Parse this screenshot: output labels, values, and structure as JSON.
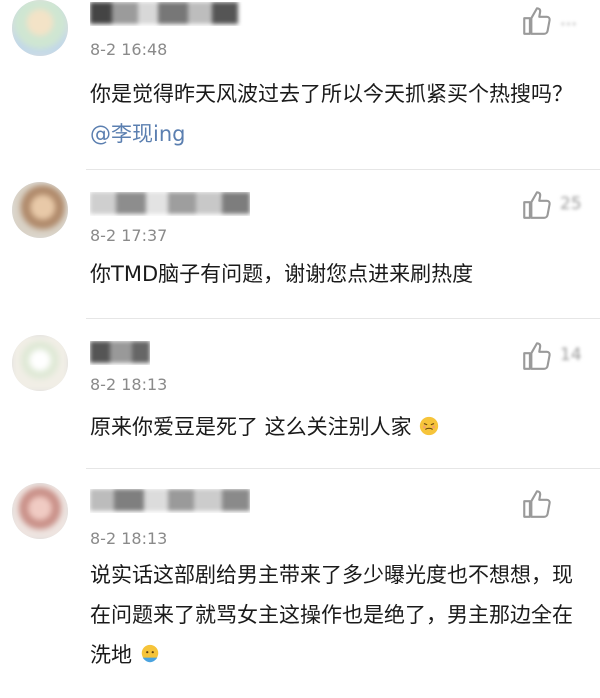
{
  "comments": [
    {
      "time": "8-2 16:48",
      "text": "你是觉得昨天风波过去了所以今天抓紧买个热搜吗？",
      "mention": "@李现ing"
    },
    {
      "time": "8-2 17:37",
      "text": "你TMD脑子有问题，谢谢您点进来刷热度",
      "like_count": "25"
    },
    {
      "time": "8-2 18:13",
      "text": "原来你爱豆是死了 这么关注别人家",
      "like_count": "14"
    },
    {
      "time": "8-2 18:13",
      "text": "说实话这部剧给男主带来了多少曝光度也不想想，现在问题来了就骂女主这操作也是绝了，男主那边全在洗地"
    }
  ],
  "icons": {
    "like": "thumbs-up-icon",
    "emoji_1": "embarrassed-face-emoji",
    "emoji_2": "face-emoji"
  },
  "colors": {
    "mention": "#5b7fb0",
    "time": "#8a8a8a",
    "divider": "#e6e6e6"
  }
}
